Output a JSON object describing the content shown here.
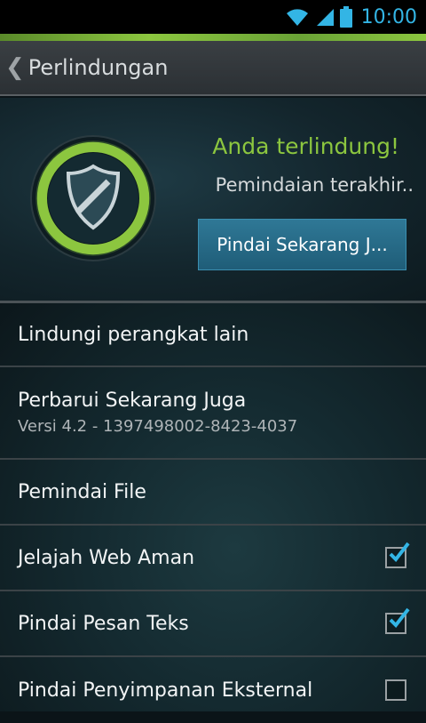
{
  "status_bar": {
    "time": "10:00"
  },
  "app_bar": {
    "title": "Perlindungan"
  },
  "protection": {
    "status": "Anda terlindung!",
    "last_scan": "Pemindaian terakhir..",
    "scan_button": "Pindai Sekarang J..."
  },
  "menu": [
    {
      "label": "Lindungi perangkat lain"
    },
    {
      "label": "Perbarui Sekarang Juga",
      "sub": "Versi 4.2 - 1397498002-8423-4037"
    },
    {
      "label": "Pemindai File"
    },
    {
      "label": "Jelajah Web Aman",
      "checked": true
    },
    {
      "label": "Pindai Pesan Teks",
      "checked": true
    },
    {
      "label": "Pindai Penyimpanan Eksternal",
      "checked": false
    }
  ],
  "colors": {
    "accent_green": "#8cc63f",
    "accent_blue": "#33b5e5"
  }
}
